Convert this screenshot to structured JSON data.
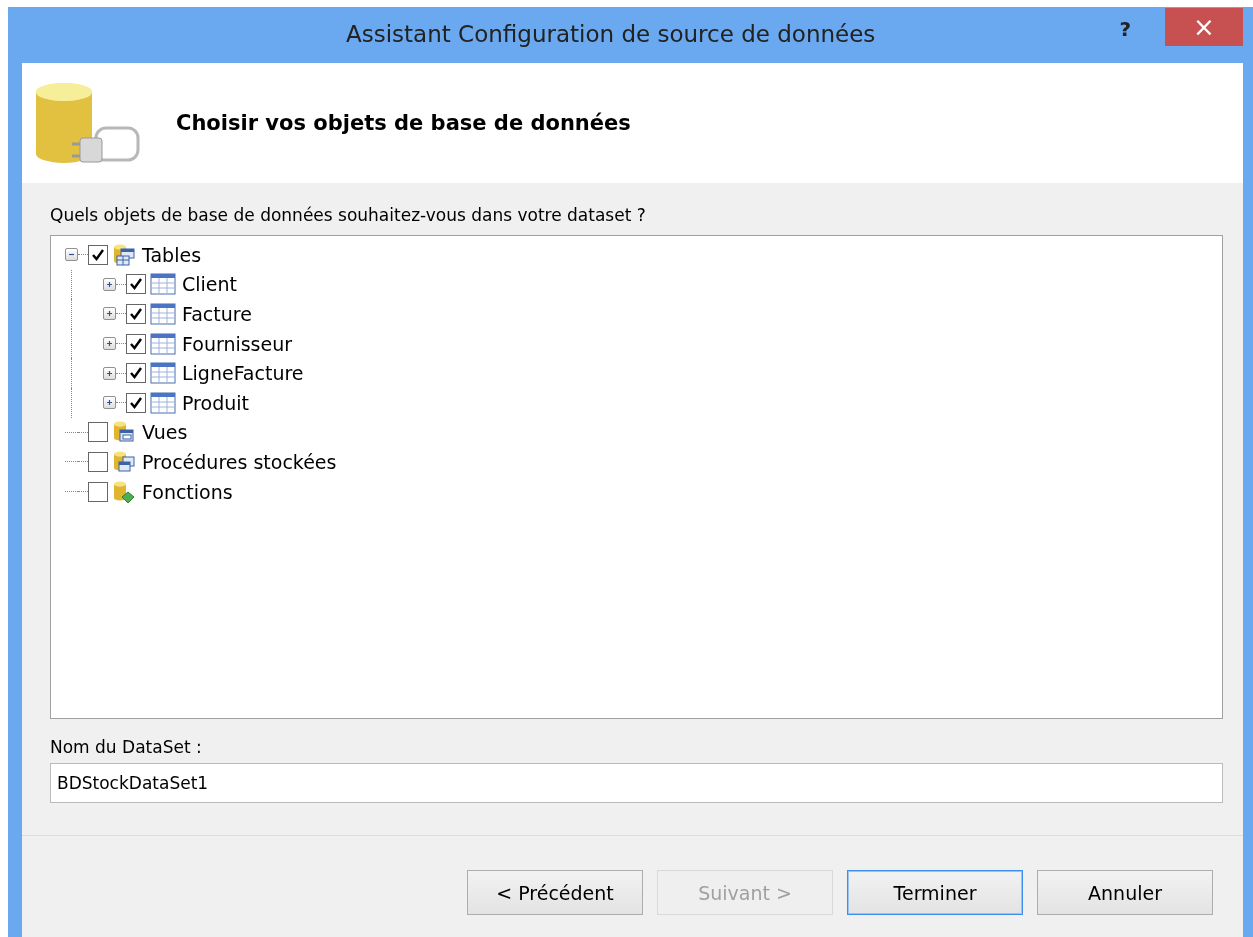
{
  "window": {
    "title": "Assistant Configuration de source de données",
    "help": "?",
    "close": "×"
  },
  "header": {
    "title": "Choisir vos objets de base de données"
  },
  "prompt": "Quels objets de base de données souhaitez-vous dans votre dataset ?",
  "tree": [
    {
      "label": "Tables",
      "kind": "tables",
      "checked": true,
      "expanded": true,
      "children": [
        {
          "label": "Client",
          "kind": "table",
          "checked": true,
          "expanded": false
        },
        {
          "label": "Facture",
          "kind": "table",
          "checked": true,
          "expanded": false
        },
        {
          "label": "Fournisseur",
          "kind": "table",
          "checked": true,
          "expanded": false
        },
        {
          "label": "LigneFacture",
          "kind": "table",
          "checked": true,
          "expanded": false
        },
        {
          "label": "Produit",
          "kind": "table",
          "checked": true,
          "expanded": false
        }
      ]
    },
    {
      "label": "Vues",
      "kind": "views",
      "checked": false
    },
    {
      "label": "Procédures stockées",
      "kind": "procedures",
      "checked": false
    },
    {
      "label": "Fonctions",
      "kind": "functions",
      "checked": false
    }
  ],
  "dataset": {
    "label": "Nom du DataSet :",
    "value": "BDStockDataSet1"
  },
  "buttons": [
    {
      "label": "< Précédent",
      "disabled": false,
      "selected": false
    },
    {
      "label": "Suivant >",
      "disabled": true,
      "selected": false
    },
    {
      "label": "Terminer",
      "disabled": false,
      "selected": true
    },
    {
      "label": "Annuler",
      "disabled": false,
      "selected": false
    }
  ]
}
